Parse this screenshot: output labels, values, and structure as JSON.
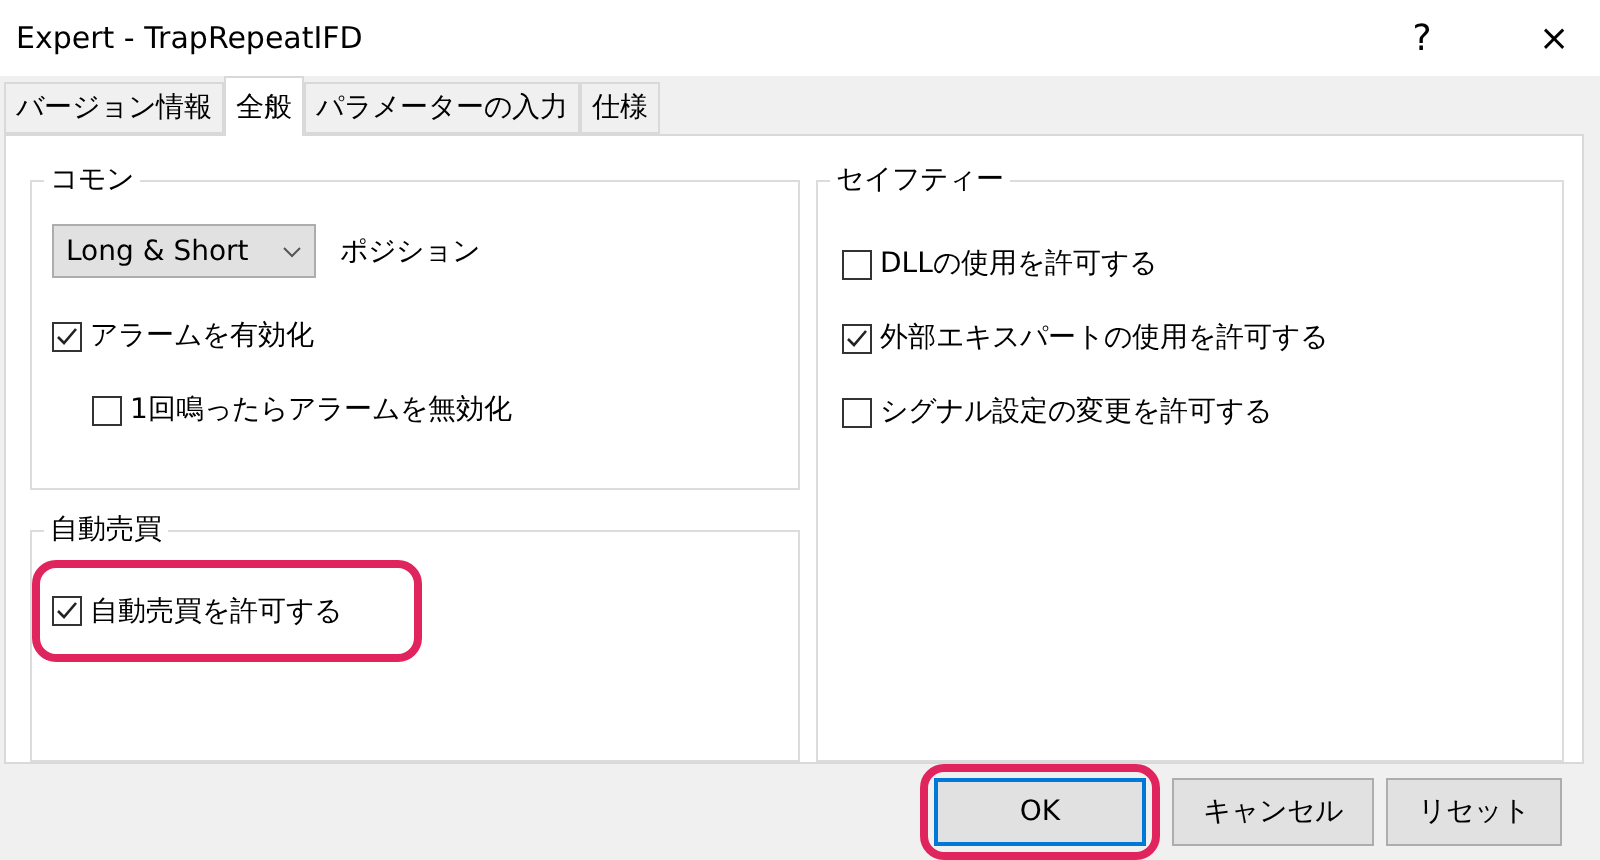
{
  "window": {
    "title": "Expert - TrapRepeatIFD",
    "help": "?",
    "close": "×"
  },
  "tabs": [
    {
      "label": "バージョン情報",
      "selected": false
    },
    {
      "label": "全般",
      "selected": true
    },
    {
      "label": "パラメーターの入力",
      "selected": false
    },
    {
      "label": "仕様",
      "selected": false
    }
  ],
  "common": {
    "title": "コモン",
    "position_select": {
      "value": "Long & Short"
    },
    "position_label": "ポジション",
    "options": [
      {
        "label": "アラームを有効化",
        "checked": true,
        "children": [
          {
            "label": "1回鳴ったらアラームを無効化",
            "checked": false
          }
        ]
      }
    ]
  },
  "auto_trading": {
    "title": "自動売買",
    "options": [
      {
        "label": "自動売買を許可する",
        "checked": true,
        "highlighted": true
      }
    ]
  },
  "safety": {
    "title": "セイフティー",
    "options": [
      {
        "label": "DLLの使用を許可する",
        "checked": false
      },
      {
        "label": "外部エキスパートの使用を許可する",
        "checked": true
      },
      {
        "label": "シグナル設定の変更を許可する",
        "checked": false
      }
    ]
  },
  "buttons": [
    {
      "label": "OK",
      "default": true,
      "highlighted": true
    },
    {
      "label": "キャンセル",
      "default": false,
      "highlighted": false
    },
    {
      "label": "リセット",
      "default": false,
      "highlighted": false
    }
  ]
}
